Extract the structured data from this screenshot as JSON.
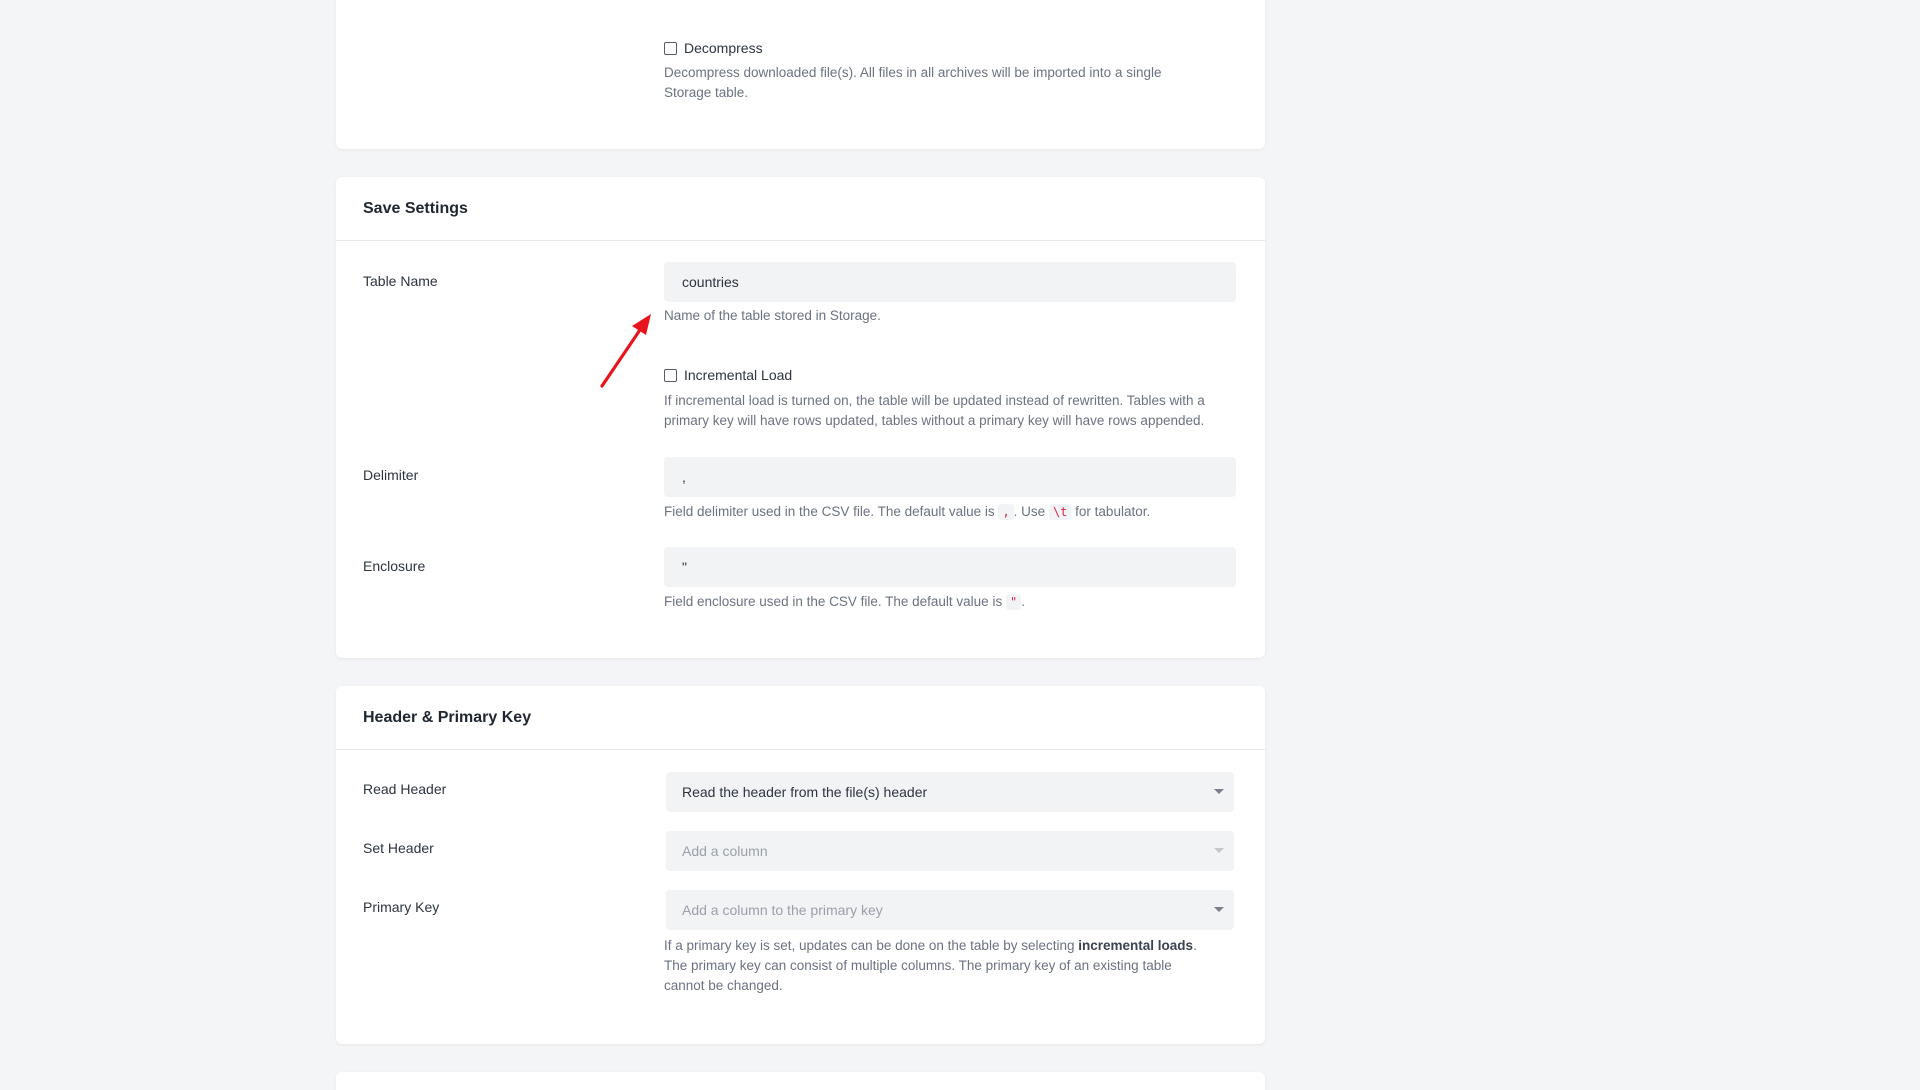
{
  "decompress": {
    "checkbox_label": "Decompress",
    "help_line1": "Decompress downloaded file(s). All files in all archives will be imported into a single",
    "help_line2": "Storage table."
  },
  "save_settings": {
    "title": "Save Settings",
    "table_name": {
      "label": "Table Name",
      "value": "countries",
      "help": "Name of the table stored in Storage."
    },
    "incremental": {
      "checkbox_label": "Incremental Load",
      "help_line1": "If incremental load is turned on, the table will be updated instead of rewritten. Tables with a",
      "help_line2": "primary key will have rows updated, tables without a primary key will have rows appended."
    },
    "delimiter": {
      "label": "Delimiter",
      "value": ",",
      "help_pre": "Field delimiter used in the CSV file. The default value is",
      "help_code1": ",",
      "help_mid": ". Use",
      "help_code2": "\\t",
      "help_post": "for tabulator."
    },
    "enclosure": {
      "label": "Enclosure",
      "value": "\"",
      "help_pre": "Field enclosure used in the CSV file. The default value is",
      "help_code": "\"",
      "help_post": "."
    }
  },
  "header_pk": {
    "title": "Header & Primary Key",
    "read_header": {
      "label": "Read Header",
      "value": "Read the header from the file(s) header"
    },
    "set_header": {
      "label": "Set Header",
      "placeholder": "Add a column"
    },
    "primary_key": {
      "label": "Primary Key",
      "placeholder": "Add a column to the primary key",
      "help_pre": "If a primary key is set, updates can be done on the table by selecting",
      "help_bold": "incremental loads",
      "help_post": ".",
      "help_line2": "The primary key can consist of multiple columns. The primary key of an existing table",
      "help_line3": "cannot be changed."
    }
  },
  "colors": {
    "background": "#f4f5f7",
    "card": "#ffffff",
    "input_bg": "#f2f3f5",
    "code_text": "#d6264a",
    "annotation_arrow": "#e8141b"
  }
}
